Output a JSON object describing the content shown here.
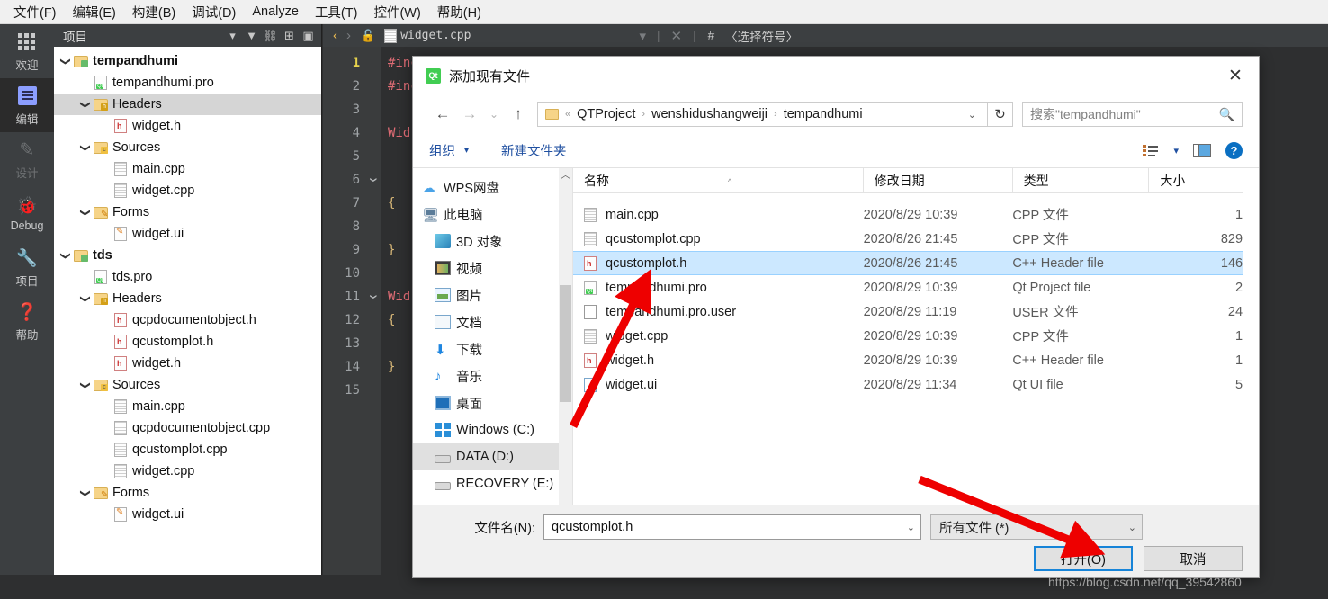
{
  "menubar": {
    "items": [
      "文件(F)",
      "编辑(E)",
      "构建(B)",
      "调试(D)",
      "Analyze",
      "工具(T)",
      "控件(W)",
      "帮助(H)"
    ]
  },
  "modebar": {
    "items": [
      {
        "label": "欢迎",
        "icon": "grid-icon",
        "state": "normal"
      },
      {
        "label": "编辑",
        "icon": "edit-icon",
        "state": "active"
      },
      {
        "label": "设计",
        "icon": "pencil-icon",
        "state": "disabled"
      },
      {
        "label": "Debug",
        "icon": "bug-icon",
        "state": "normal"
      },
      {
        "label": "项目",
        "icon": "wrench-icon",
        "state": "normal"
      },
      {
        "label": "帮助",
        "icon": "question-icon",
        "state": "normal"
      }
    ]
  },
  "project_pane": {
    "title": "项目",
    "tools": [
      "filter-icon",
      "link-icon",
      "split-icon",
      "minimize-icon"
    ],
    "tree": [
      {
        "label": "tempandhumi",
        "depth": 0,
        "arrow": "v",
        "icon": "qt-folder-icon",
        "bold": true,
        "selected": false
      },
      {
        "label": "tempandhumi.pro",
        "depth": 1,
        "arrow": "",
        "icon": "qt-pro-icon",
        "bold": false,
        "selected": false
      },
      {
        "label": "Headers",
        "depth": 1,
        "arrow": "v",
        "icon": "headers-folder-icon",
        "bold": false,
        "selected": true
      },
      {
        "label": "widget.h",
        "depth": 2,
        "arrow": "",
        "icon": "h-file-icon",
        "bold": false,
        "selected": false
      },
      {
        "label": "Sources",
        "depth": 1,
        "arrow": "v",
        "icon": "sources-folder-icon",
        "bold": false,
        "selected": false
      },
      {
        "label": "main.cpp",
        "depth": 2,
        "arrow": "",
        "icon": "cpp-file-icon",
        "bold": false,
        "selected": false
      },
      {
        "label": "widget.cpp",
        "depth": 2,
        "arrow": "",
        "icon": "cpp-file-icon",
        "bold": false,
        "selected": false
      },
      {
        "label": "Forms",
        "depth": 1,
        "arrow": "v",
        "icon": "forms-folder-icon",
        "bold": false,
        "selected": false
      },
      {
        "label": "widget.ui",
        "depth": 2,
        "arrow": "",
        "icon": "ui-file-icon",
        "bold": false,
        "selected": false
      },
      {
        "label": "tds",
        "depth": 0,
        "arrow": "v",
        "icon": "qt-folder-icon",
        "bold": true,
        "selected": false
      },
      {
        "label": "tds.pro",
        "depth": 1,
        "arrow": "",
        "icon": "qt-pro-icon",
        "bold": false,
        "selected": false
      },
      {
        "label": "Headers",
        "depth": 1,
        "arrow": "v",
        "icon": "headers-folder-icon",
        "bold": false,
        "selected": false
      },
      {
        "label": "qcpdocumentobject.h",
        "depth": 2,
        "arrow": "",
        "icon": "h-file-icon",
        "bold": false,
        "selected": false
      },
      {
        "label": "qcustomplot.h",
        "depth": 2,
        "arrow": "",
        "icon": "h-file-icon",
        "bold": false,
        "selected": false
      },
      {
        "label": "widget.h",
        "depth": 2,
        "arrow": "",
        "icon": "h-file-icon",
        "bold": false,
        "selected": false
      },
      {
        "label": "Sources",
        "depth": 1,
        "arrow": "v",
        "icon": "sources-folder-icon",
        "bold": false,
        "selected": false
      },
      {
        "label": "main.cpp",
        "depth": 2,
        "arrow": "",
        "icon": "cpp-file-icon",
        "bold": false,
        "selected": false
      },
      {
        "label": "qcpdocumentobject.cpp",
        "depth": 2,
        "arrow": "",
        "icon": "cpp-file-icon",
        "bold": false,
        "selected": false
      },
      {
        "label": "qcustomplot.cpp",
        "depth": 2,
        "arrow": "",
        "icon": "cpp-file-icon",
        "bold": false,
        "selected": false
      },
      {
        "label": "widget.cpp",
        "depth": 2,
        "arrow": "",
        "icon": "cpp-file-icon",
        "bold": false,
        "selected": false
      },
      {
        "label": "Forms",
        "depth": 1,
        "arrow": "v",
        "icon": "forms-folder-icon",
        "bold": false,
        "selected": false
      },
      {
        "label": "widget.ui",
        "depth": 2,
        "arrow": "",
        "icon": "ui-file-icon",
        "bold": false,
        "selected": false
      }
    ]
  },
  "editor": {
    "tabbar": {
      "back": "‹",
      "forward": "›",
      "lock": "lock-open-icon",
      "file_icon": "cpp-file-icon",
      "filename": "widget.cpp",
      "dropdown": "▾",
      "close": "✕",
      "hash": "#",
      "symbol_selector": "〈选择符号〉"
    },
    "line_numbers": [
      "1",
      "2",
      "3",
      "4",
      "5",
      "6",
      "7",
      "8",
      "9",
      "10",
      "11",
      "12",
      "13",
      "14",
      "15"
    ],
    "current_line": "1",
    "fold_markers": {
      "6": "v",
      "11": "v"
    },
    "lines": [
      {
        "n": "1",
        "text": "#include \"widget.h\""
      },
      {
        "n": "2",
        "text": "#include"
      },
      {
        "n": "3",
        "text": ""
      },
      {
        "n": "4",
        "text": "Wid"
      },
      {
        "n": "5",
        "text": ""
      },
      {
        "n": "6",
        "text": ""
      },
      {
        "n": "7",
        "text": "{"
      },
      {
        "n": "8",
        "text": ""
      },
      {
        "n": "9",
        "text": "}"
      },
      {
        "n": "10",
        "text": ""
      },
      {
        "n": "11",
        "text": "Wid"
      },
      {
        "n": "12",
        "text": "{"
      },
      {
        "n": "13",
        "text": ""
      },
      {
        "n": "14",
        "text": "}"
      },
      {
        "n": "15",
        "text": ""
      }
    ]
  },
  "dialog": {
    "title": "添加现有文件",
    "title_icon": "qt-icon",
    "close_label": "✕",
    "nav": {
      "back": "←",
      "forward": "→",
      "recent": "⌄",
      "up": "↑",
      "refresh": "↻",
      "breadcrumb": {
        "prefix": "«",
        "segments": [
          "QTProject",
          "wenshidushangweiji",
          "tempandhumi"
        ],
        "separator": "›",
        "caret": "⌄"
      },
      "search_placeholder": "搜索\"tempandhumi\"",
      "search_value": "",
      "search_icon": "magnifier-icon"
    },
    "toolbar": {
      "organize": "组织",
      "organize_caret": "▾",
      "new_folder": "新建文件夹",
      "view_icon": "view-list-icon",
      "view_caret": "▾",
      "pane_icon": "preview-pane-icon",
      "help_icon": "help-icon"
    },
    "sidebar": [
      {
        "label": "WPS网盘",
        "icon": "cloud-icon",
        "indent": 0,
        "selected": false
      },
      {
        "label": "此电脑",
        "icon": "pc-icon",
        "indent": 0,
        "selected": false
      },
      {
        "label": "3D 对象",
        "icon": "cube-icon",
        "indent": 1,
        "selected": false
      },
      {
        "label": "视频",
        "icon": "video-icon",
        "indent": 1,
        "selected": false
      },
      {
        "label": "图片",
        "icon": "picture-icon",
        "indent": 1,
        "selected": false
      },
      {
        "label": "文档",
        "icon": "document-icon",
        "indent": 1,
        "selected": false
      },
      {
        "label": "下载",
        "icon": "download-icon",
        "indent": 1,
        "selected": false
      },
      {
        "label": "音乐",
        "icon": "music-icon",
        "indent": 1,
        "selected": false
      },
      {
        "label": "桌面",
        "icon": "desktop-icon",
        "indent": 1,
        "selected": false
      },
      {
        "label": "Windows (C:)",
        "icon": "windows-drive-icon",
        "indent": 1,
        "selected": false
      },
      {
        "label": "DATA (D:)",
        "icon": "drive-icon",
        "indent": 1,
        "selected": true
      },
      {
        "label": "RECOVERY (E:)",
        "icon": "drive-icon",
        "indent": 1,
        "selected": false
      }
    ],
    "columns": [
      "名称",
      "修改日期",
      "类型",
      "大小"
    ],
    "sort_indicator": "^",
    "files": [
      {
        "name": "main.cpp",
        "date": "2020/8/29 10:39",
        "type": "CPP 文件",
        "size": "1",
        "icon": "cpp-file-icon",
        "selected": false
      },
      {
        "name": "qcustomplot.cpp",
        "date": "2020/8/26 21:45",
        "type": "CPP 文件",
        "size": "829",
        "icon": "cpp-file-icon",
        "selected": false
      },
      {
        "name": "qcustomplot.h",
        "date": "2020/8/26 21:45",
        "type": "C++ Header file",
        "size": "146",
        "icon": "h-file-icon",
        "selected": true
      },
      {
        "name": "tempandhumi.pro",
        "date": "2020/8/29 10:39",
        "type": "Qt Project file",
        "size": "2",
        "icon": "pro-file-icon",
        "selected": false
      },
      {
        "name": "tempandhumi.pro.user",
        "date": "2020/8/29 11:19",
        "type": "USER 文件",
        "size": "24",
        "icon": "user-file-icon",
        "selected": false
      },
      {
        "name": "widget.cpp",
        "date": "2020/8/29 10:39",
        "type": "CPP 文件",
        "size": "1",
        "icon": "cpp-file-icon",
        "selected": false
      },
      {
        "name": "widget.h",
        "date": "2020/8/29 10:39",
        "type": "C++ Header file",
        "size": "1",
        "icon": "h-file-icon",
        "selected": false
      },
      {
        "name": "widget.ui",
        "date": "2020/8/29 11:34",
        "type": "Qt UI file",
        "size": "5",
        "icon": "ui-file-icon",
        "selected": false
      }
    ],
    "footer": {
      "filename_label": "文件名(N):",
      "filename_value": "qcustomplot.h",
      "filter_value": "所有文件 (*)",
      "open_button": "打开(O)",
      "cancel_button": "取消"
    }
  },
  "watermark": "https://blog.csdn.net/qq_39542860"
}
